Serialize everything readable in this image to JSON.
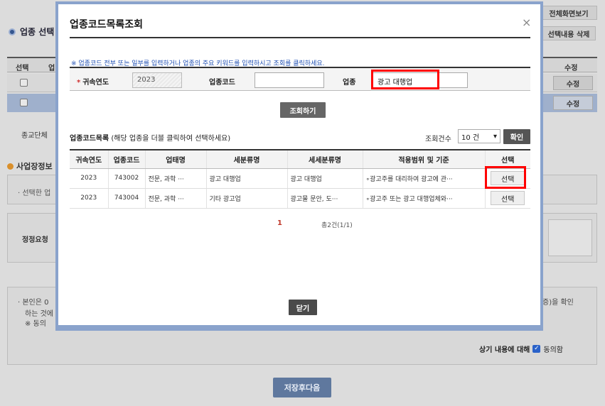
{
  "background": {
    "full_screen_button": "전체화면보기",
    "section_title": "업종 선택",
    "delete_selection_button": "선택내용 삭제",
    "table_headers": [
      "선택",
      "업",
      "수정"
    ],
    "edit_label": "수정",
    "cut_text_1": "종교단체",
    "business_info_title": "사업장정보",
    "selected_text": "· 선택한 업",
    "correction_label": "정정요청",
    "consent_line1": "· 본인은 0",
    "consent_line2": "하는 것에",
    "consent_line3": "※ 동의",
    "consent_tail": "증)을 확인",
    "agree_label": "상기 내용에 대해",
    "agree_checkbox_text": "동의함",
    "save_next_button": "저장후다음"
  },
  "modal": {
    "title": "업종코드목록조회",
    "close_glyph": "×",
    "notice": "※ 업종코드 전부 또는 일부를 입력하거나 업종의 주요 키워드를 입력하시고 조회를 클릭하세요.",
    "form": {
      "required_mark": "*",
      "year_label": "귀속연도",
      "year_value": "2023",
      "code_label": "업종코드",
      "code_value": "",
      "industry_label": "업종",
      "industry_value": "광고 대행업"
    },
    "search_button": "조회하기",
    "list_title_bold": "업종코드목록",
    "list_title_hint": "(해당 업종을 더블 클릭하여 선택하세요)",
    "count_label": "조회건수",
    "count_value": "10 건",
    "confirm_button": "확인",
    "columns": [
      "귀속연도",
      "업종코드",
      "업태명",
      "세분류명",
      "세세분류명",
      "적용범위 및 기준",
      "선택"
    ],
    "rows": [
      {
        "year": "2023",
        "code": "743002",
        "business": "전문, 과학 ···",
        "sub": "광고 대행업",
        "subsub": "광고 대행업",
        "scope": "∘광고주를 대리하여 광고에 관···",
        "select": "선택"
      },
      {
        "year": "2023",
        "code": "743004",
        "business": "전문, 과학 ···",
        "sub": "기타 광고업",
        "subsub": "광고물 문안, 도···",
        "scope": "∘광고주 또는 광고 대행업체와···",
        "select": "선택"
      }
    ],
    "page_number": "1",
    "total_text": "총2건(1/1)",
    "close_button": "닫기"
  }
}
